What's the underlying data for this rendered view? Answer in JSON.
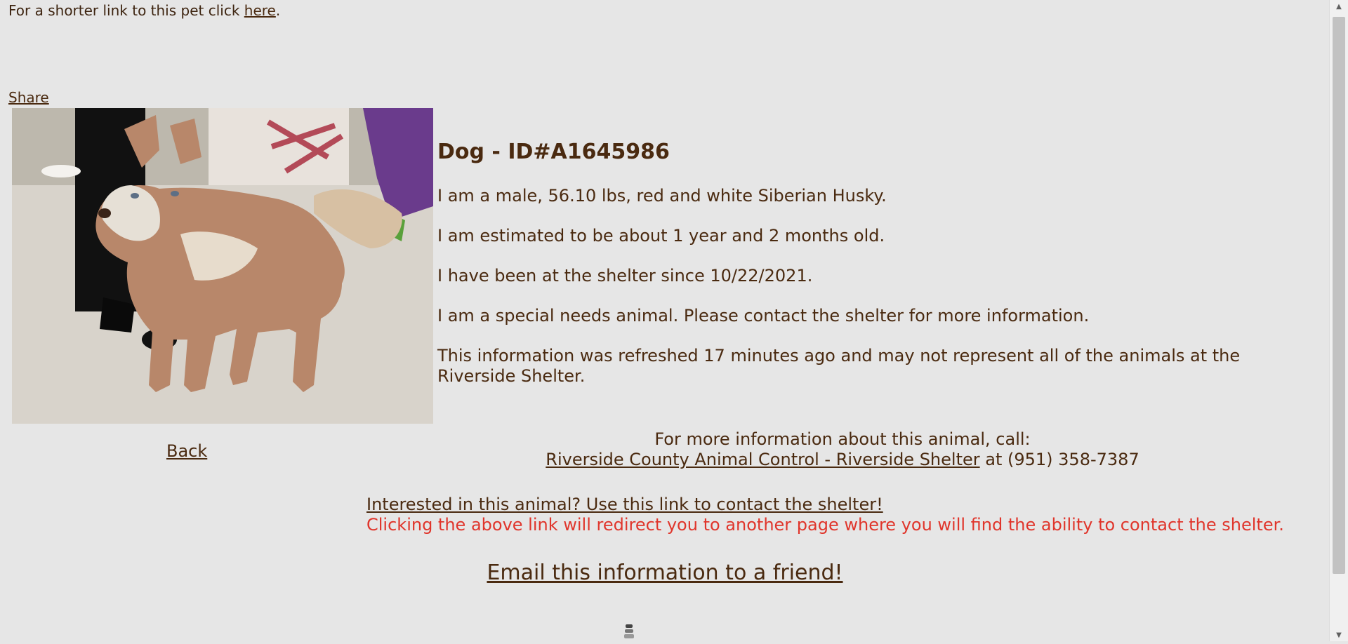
{
  "shortlink": {
    "text_before": "For a shorter link to this pet click ",
    "link_text": "here",
    "text_after": "."
  },
  "share_label": "Share",
  "pet": {
    "title": "Dog - ID#A1645986",
    "description": "I am a male, 56.10 lbs, red and white Siberian Husky.",
    "age": "I am estimated to be about 1 year and 2 months old.",
    "since": "I have been at the shelter since 10/22/2021.",
    "special_needs": "I am a special needs animal. Please contact the shelter for more information.",
    "refresh_note": "This information was refreshed 17 minutes ago and may not represent all of the animals at the Riverside Shelter."
  },
  "back_label": "Back",
  "contact": {
    "intro": "For more information about this animal, call:",
    "shelter_link": "Riverside County Animal Control - Riverside Shelter",
    "phone_text": " at (951) 358-7387"
  },
  "interest_link": "Interested in this animal? Use this link to contact the shelter!",
  "redirect_note": "Clicking the above link will redirect you to another page where you will find the ability to contact the shelter.",
  "email_link": "Email this information to a friend!",
  "colors": {
    "background": "#e6e6e6",
    "text": "#4a2a10",
    "warning": "#e0352b"
  },
  "icons": {
    "photo": "husky-photo",
    "spinner": "loading-spinner-icon",
    "scroll_up": "scroll-up-arrow-icon",
    "scroll_down": "scroll-down-arrow-icon"
  }
}
